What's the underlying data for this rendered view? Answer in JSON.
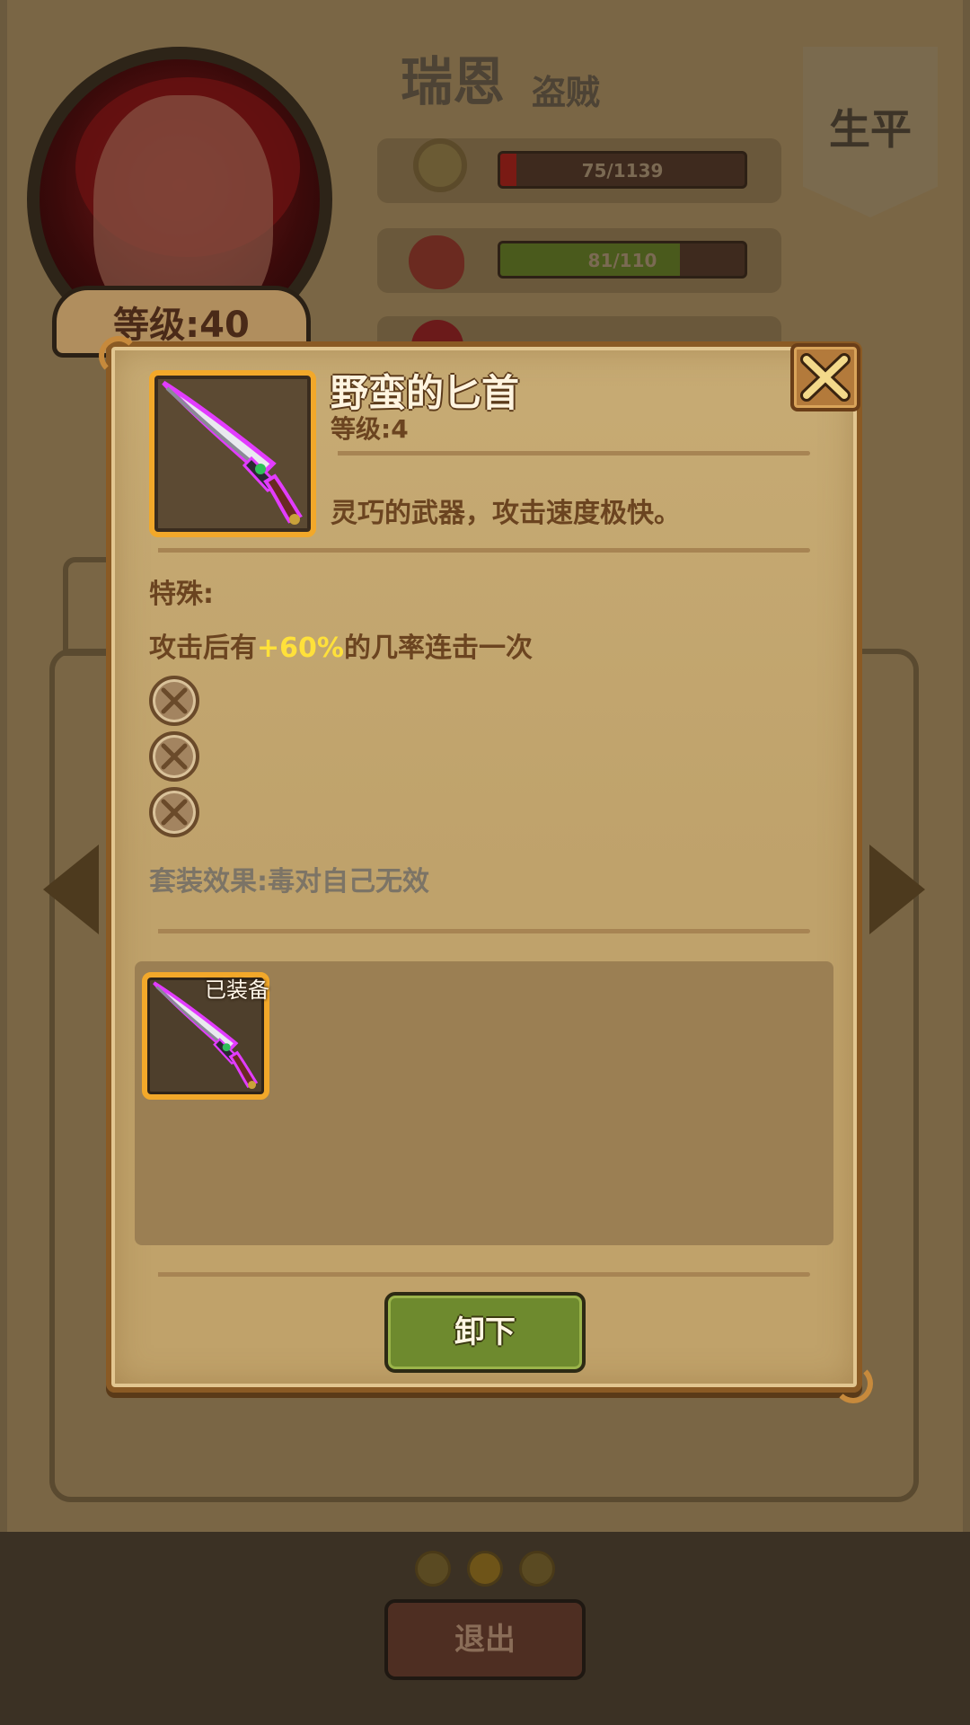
{
  "hero": {
    "name": "瑞恩",
    "class": "盗贼",
    "level_label": "等级:40",
    "career_button": "生平",
    "stats": [
      {
        "text": "75/1139",
        "fraction": 0.066
      },
      {
        "text": "81/110",
        "fraction": 0.736
      }
    ]
  },
  "modal": {
    "item_name": "野蛮的匕首",
    "item_level": "等级:4",
    "item_description": "灵巧的武器，攻击速度极快。",
    "special_title": "特殊:",
    "special_prefix": "攻击后有",
    "special_value": "+60%",
    "special_suffix": "的几率连击一次",
    "empty_sockets": 3,
    "set_effect": "套装效果:毒对自己无效",
    "equipped_badge": "已装备",
    "unequip_button": "卸下",
    "highlight_color": "#ffe13a",
    "item_rarity_color": "#e23cff",
    "frame_color": "#f2a82a"
  },
  "footer": {
    "exit_button": "退出",
    "page_count": 3,
    "active_page": 2
  }
}
